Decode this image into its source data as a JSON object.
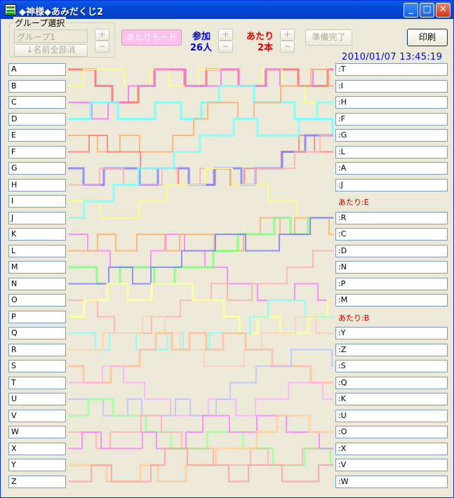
{
  "window": {
    "title": "◆神様◆あみだくじ2",
    "minimize": "_",
    "maximize": "□",
    "close": "✕"
  },
  "group": {
    "label": "グループ選択",
    "name_value": "グループ1",
    "plus": "+",
    "minus": "−",
    "all_button": "↓名前全部消"
  },
  "toolbar": {
    "atari_mode": "あたりモード",
    "participants_label": "参加",
    "participants_count": "26人",
    "winners_label": "あたり",
    "winners_count": "2本",
    "plus": "+",
    "minus": "−",
    "ready_button": "準備完了",
    "print_button": "印刷"
  },
  "datetime": "2010/01/07 13:45:19",
  "colors": {
    "title_blue": "#0446d8",
    "participants_blue": "#0000cc",
    "winners_red": "#e00000",
    "win_text": "#c00000"
  },
  "names": [
    "A",
    "B",
    "C",
    "D",
    "E",
    "F",
    "G",
    "H",
    "I",
    "J",
    "K",
    "L",
    "M",
    "N",
    "O",
    "P",
    "Q",
    "R",
    "S",
    "T",
    "U",
    "V",
    "W",
    "X",
    "Y",
    "Z"
  ],
  "results": [
    ":T",
    ":I",
    ":H",
    ":F",
    ":G",
    ":L",
    ":A",
    ":J",
    "あたり:E",
    ":R",
    ":C",
    ":D",
    ":N",
    ":P",
    ":M",
    "あたり:B",
    ":Y",
    ":Z",
    ":S",
    ":Q",
    ":K",
    ":U",
    ":O",
    ":X",
    ":V",
    ":W"
  ],
  "winner_rows": [
    8,
    15
  ],
  "line_colors": [
    "#ff7070",
    "#ffff80",
    "#ff70ff",
    "#70ffff",
    "#ffb070",
    "#ff8080",
    "#8080ff",
    "#ffb0b0",
    "#ffff80",
    "#80ffff",
    "#ff80ff",
    "#ffb070",
    "#80ff80",
    "#8080ff",
    "#ffb0b0",
    "#ffffa0",
    "#80ffff",
    "#ffd0b0",
    "#ffc0a0",
    "#ffb0ff",
    "#c0c0ff",
    "#a0ffa0",
    "#ffb0b0",
    "#ff80ff",
    "#ffd0a0",
    "#ffa0a0"
  ]
}
